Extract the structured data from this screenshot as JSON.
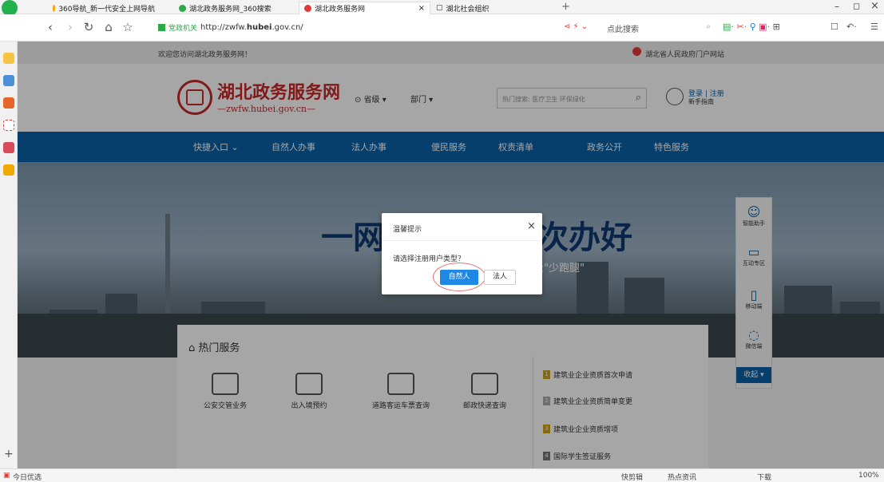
{
  "browser": {
    "tabs": [
      {
        "label": "360导航_新一代安全上网导航",
        "active": false
      },
      {
        "label": "湖北政务服务网_360搜索",
        "active": false
      },
      {
        "label": "湖北政务服务网",
        "active": true
      },
      {
        "label": "湖北社会组织",
        "active": false
      }
    ],
    "address_badge": "党政机关",
    "address_url_prefix": "http://zwfw.",
    "address_url_bold": "hubei",
    "address_url_suffix": ".gov.cn/",
    "search_placeholder": "点此搜索",
    "status_left": "今日优选",
    "status_items": [
      "快剪辑",
      "热点资讯",
      "下载"
    ],
    "zoom": "100%"
  },
  "page": {
    "welcome": "欢迎您访问湖北政务服务网！",
    "gov_portal": "湖北省人民政府门户网站",
    "site_title": "湖北政务服务网",
    "site_domain": "—zwfw.hubei.gov.cn—",
    "region": "省级",
    "dept": "部门",
    "search_placeholder": "热门搜索: 医疗卫生 环保绿化",
    "login": "登录 | 注册",
    "guide": "新手指南",
    "nav": [
      "快捷入口",
      "自然人办事",
      "法人办事",
      "便民服务",
      "权责清单",
      "政务公开",
      "特色服务"
    ],
    "banner_title_left": "一网覆盖",
    "banner_title_right": "一次办好",
    "banner_subtitle": "让群众\"少跑腿\"",
    "float": [
      "智能助手",
      "互动专区",
      "移动端",
      "微信端"
    ],
    "float_collapse": "收起",
    "services_title": "热门服务",
    "services": [
      "公安交管业务",
      "出入境预约",
      "道路客运车票查询",
      "邮政快递查询"
    ],
    "hot_list": [
      "建筑业企业资质首次申请",
      "建筑业企业资质简单变更",
      "建筑业企业资质增项",
      "国际学生签证服务"
    ]
  },
  "dialog": {
    "title": "温馨提示",
    "message": "请选择注册用户类型？",
    "btn_natural": "自然人",
    "btn_legal": "法人"
  }
}
